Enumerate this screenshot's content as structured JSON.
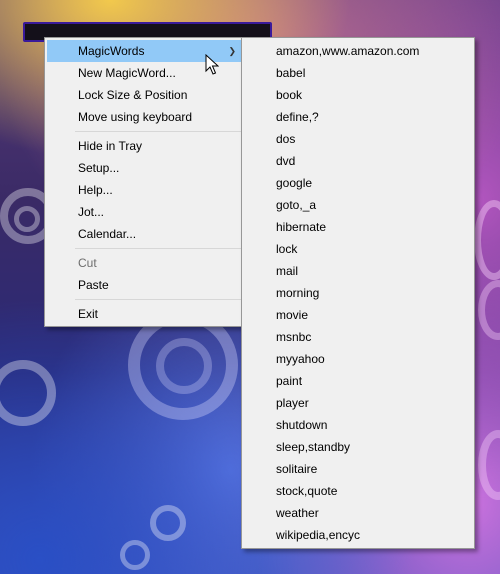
{
  "menu": {
    "items": [
      {
        "label": "MagicWords",
        "has_submenu": true,
        "highlighted": true
      },
      {
        "label": "New MagicWord..."
      },
      {
        "label": "Lock Size & Position"
      },
      {
        "label": "Move using keyboard"
      },
      {
        "label": "Hide in Tray"
      },
      {
        "label": "Setup..."
      },
      {
        "label": "Help..."
      },
      {
        "label": "Jot..."
      },
      {
        "label": "Calendar..."
      },
      {
        "label": "Cut",
        "disabled": true
      },
      {
        "label": "Paste"
      },
      {
        "label": "Exit"
      }
    ],
    "submenu_arrow": "chevron-right-icon"
  },
  "submenu": {
    "items": [
      "amazon,www.amazon.com",
      "babel",
      "book",
      "define,?",
      "dos",
      "dvd",
      "google",
      "goto,_a",
      "hibernate",
      "lock",
      "mail",
      "morning",
      "movie",
      "msnbc",
      "myyahoo",
      "paint",
      "player",
      "shutdown",
      "sleep,standby",
      "solitaire",
      "stock,quote",
      "weather",
      "wikipedia,encyc"
    ]
  },
  "colors": {
    "menu_bg": "#f0f0f0",
    "highlight": "#91c9f7",
    "disabled_text": "#6d6d6d"
  }
}
